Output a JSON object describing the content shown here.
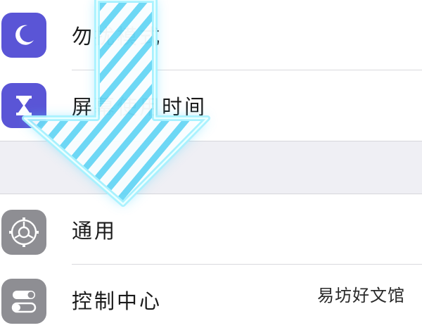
{
  "settings": {
    "rows": [
      {
        "label": "勿扰模式",
        "icon": "moon-icon"
      },
      {
        "label": "屏幕使用时间",
        "icon": "hourglass-icon"
      },
      {
        "label": "通用",
        "icon": "gear-icon"
      },
      {
        "label": "控制中心",
        "icon": "toggle-switches-icon"
      }
    ]
  },
  "overlay": {
    "icon": "down-arrow-icon",
    "color": "#7fe8ff"
  },
  "watermark": {
    "text": "易坊好文馆"
  },
  "colors": {
    "purple": "#5a55d6",
    "gray": "#8e8e93",
    "separator": "#efeff4"
  }
}
